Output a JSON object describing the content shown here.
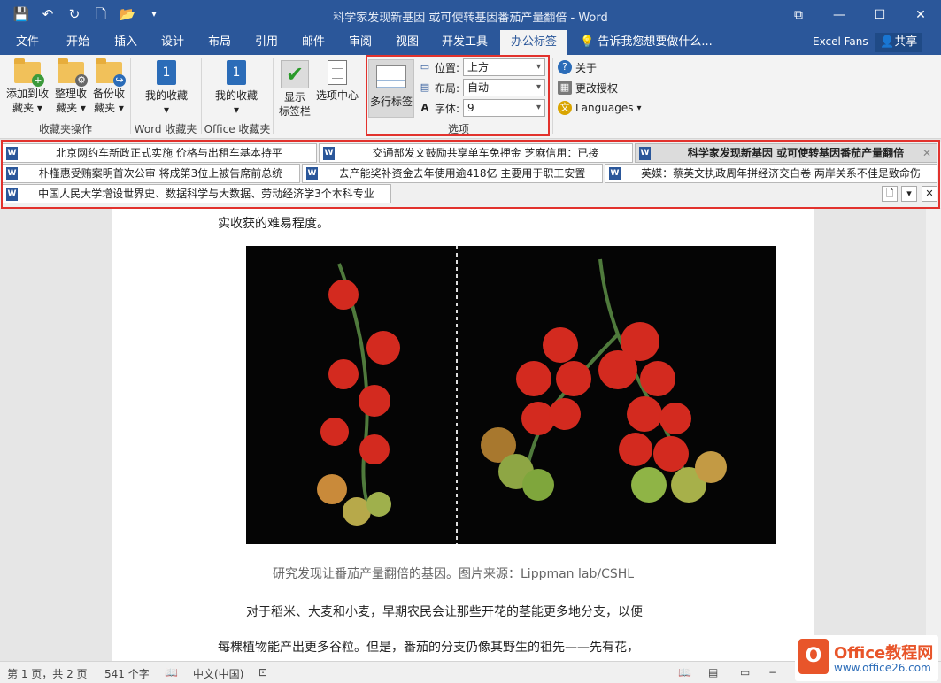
{
  "window": {
    "title": "科学家发现新基因 或可使转基因番茄产量翻倍 - Word"
  },
  "tabs": [
    {
      "label": "文件"
    },
    {
      "label": "开始"
    },
    {
      "label": "插入"
    },
    {
      "label": "设计"
    },
    {
      "label": "布局"
    },
    {
      "label": "引用"
    },
    {
      "label": "邮件"
    },
    {
      "label": "审阅"
    },
    {
      "label": "视图"
    },
    {
      "label": "开发工具"
    },
    {
      "label": "办公标签"
    }
  ],
  "tell_me": "告诉我您想要做什么...",
  "account": "Excel Fans",
  "share_label": "共享",
  "ribbon": {
    "favorites_ops": {
      "label": "收藏夹操作",
      "add": [
        "添加到收",
        "藏夹"
      ],
      "organize": [
        "整理收",
        "藏夹"
      ],
      "backup": [
        "备份收",
        "藏夹"
      ]
    },
    "word_favorites": {
      "label": "Word 收藏夹",
      "button": "我的收藏"
    },
    "office_favorites": {
      "label": "Office 收藏夹",
      "button": "我的收藏"
    },
    "show_tabbar": [
      "显示",
      "标签栏"
    ],
    "options_center": "选项中心",
    "options": {
      "label": "选项",
      "multirow": "多行标签",
      "position": {
        "label": "位置:",
        "value": "上方"
      },
      "layout": {
        "label": "布局:",
        "value": "自动"
      },
      "font": {
        "label": "字体:",
        "value": "9"
      }
    },
    "about": "关于",
    "change_license": "更改授权",
    "languages": "Languages"
  },
  "doc_tabs": [
    [
      "北京网约车新政正式实施 价格与出租车基本持平",
      "交通部发文鼓励共享单车免押金 芝麻信用：已接",
      "科学家发现新基因 或可使转基因番茄产量翻倍"
    ],
    [
      "朴槿惠受贿案明首次公审 将成第3位上被告席前总统",
      "去产能奖补资金去年使用逾418亿 主要用于职工安置",
      "英媒：蔡英文执政周年拼经济交白卷 两岸关系不佳是致命伤"
    ],
    [
      "中国人民大学增设世界史、数据科学与大数据、劳动经济学3个本科专业"
    ]
  ],
  "document": {
    "line1": "实收获的难易程度。",
    "caption": "研究发现让番茄产量翻倍的基因。图片来源：Lippman lab/CSHL",
    "para1": "对于稻米、大麦和小麦，早期农民会让那些开花的茎能更多地分支，以便",
    "para2": "每棵植物能产出更多谷粒。但是，番茄的分支仍像其野生的祖先——先有花，"
  },
  "status": {
    "page": "第 1 页，共 2 页",
    "words": "541 个字",
    "language": "中文(中国)"
  },
  "watermark": {
    "name": "Office教程网",
    "url": "www.office26.com"
  },
  "colors": {
    "accent": "#2b579a",
    "highlight": "#e2322d"
  }
}
